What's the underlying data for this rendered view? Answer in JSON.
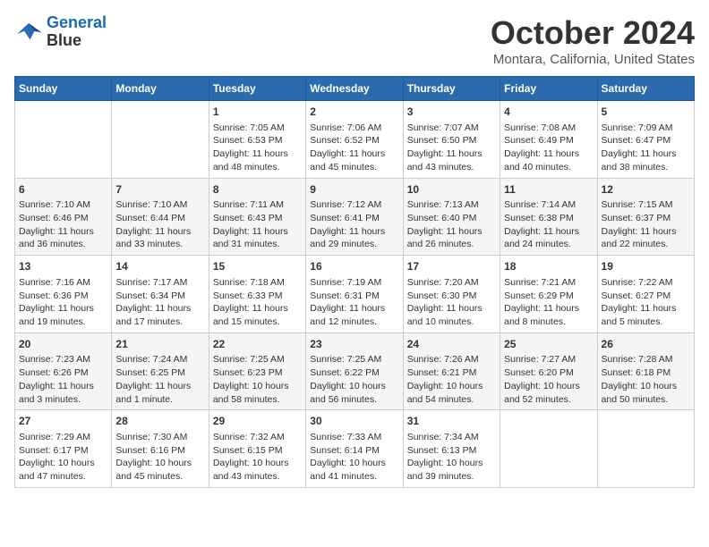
{
  "logo": {
    "line1": "General",
    "line2": "Blue"
  },
  "title": "October 2024",
  "location": "Montara, California, United States",
  "weekdays": [
    "Sunday",
    "Monday",
    "Tuesday",
    "Wednesday",
    "Thursday",
    "Friday",
    "Saturday"
  ],
  "weeks": [
    [
      {
        "day": "",
        "content": ""
      },
      {
        "day": "",
        "content": ""
      },
      {
        "day": "1",
        "content": "Sunrise: 7:05 AM\nSunset: 6:53 PM\nDaylight: 11 hours\nand 48 minutes."
      },
      {
        "day": "2",
        "content": "Sunrise: 7:06 AM\nSunset: 6:52 PM\nDaylight: 11 hours\nand 45 minutes."
      },
      {
        "day": "3",
        "content": "Sunrise: 7:07 AM\nSunset: 6:50 PM\nDaylight: 11 hours\nand 43 minutes."
      },
      {
        "day": "4",
        "content": "Sunrise: 7:08 AM\nSunset: 6:49 PM\nDaylight: 11 hours\nand 40 minutes."
      },
      {
        "day": "5",
        "content": "Sunrise: 7:09 AM\nSunset: 6:47 PM\nDaylight: 11 hours\nand 38 minutes."
      }
    ],
    [
      {
        "day": "6",
        "content": "Sunrise: 7:10 AM\nSunset: 6:46 PM\nDaylight: 11 hours\nand 36 minutes."
      },
      {
        "day": "7",
        "content": "Sunrise: 7:10 AM\nSunset: 6:44 PM\nDaylight: 11 hours\nand 33 minutes."
      },
      {
        "day": "8",
        "content": "Sunrise: 7:11 AM\nSunset: 6:43 PM\nDaylight: 11 hours\nand 31 minutes."
      },
      {
        "day": "9",
        "content": "Sunrise: 7:12 AM\nSunset: 6:41 PM\nDaylight: 11 hours\nand 29 minutes."
      },
      {
        "day": "10",
        "content": "Sunrise: 7:13 AM\nSunset: 6:40 PM\nDaylight: 11 hours\nand 26 minutes."
      },
      {
        "day": "11",
        "content": "Sunrise: 7:14 AM\nSunset: 6:38 PM\nDaylight: 11 hours\nand 24 minutes."
      },
      {
        "day": "12",
        "content": "Sunrise: 7:15 AM\nSunset: 6:37 PM\nDaylight: 11 hours\nand 22 minutes."
      }
    ],
    [
      {
        "day": "13",
        "content": "Sunrise: 7:16 AM\nSunset: 6:36 PM\nDaylight: 11 hours\nand 19 minutes."
      },
      {
        "day": "14",
        "content": "Sunrise: 7:17 AM\nSunset: 6:34 PM\nDaylight: 11 hours\nand 17 minutes."
      },
      {
        "day": "15",
        "content": "Sunrise: 7:18 AM\nSunset: 6:33 PM\nDaylight: 11 hours\nand 15 minutes."
      },
      {
        "day": "16",
        "content": "Sunrise: 7:19 AM\nSunset: 6:31 PM\nDaylight: 11 hours\nand 12 minutes."
      },
      {
        "day": "17",
        "content": "Sunrise: 7:20 AM\nSunset: 6:30 PM\nDaylight: 11 hours\nand 10 minutes."
      },
      {
        "day": "18",
        "content": "Sunrise: 7:21 AM\nSunset: 6:29 PM\nDaylight: 11 hours\nand 8 minutes."
      },
      {
        "day": "19",
        "content": "Sunrise: 7:22 AM\nSunset: 6:27 PM\nDaylight: 11 hours\nand 5 minutes."
      }
    ],
    [
      {
        "day": "20",
        "content": "Sunrise: 7:23 AM\nSunset: 6:26 PM\nDaylight: 11 hours\nand 3 minutes."
      },
      {
        "day": "21",
        "content": "Sunrise: 7:24 AM\nSunset: 6:25 PM\nDaylight: 11 hours\nand 1 minute."
      },
      {
        "day": "22",
        "content": "Sunrise: 7:25 AM\nSunset: 6:23 PM\nDaylight: 10 hours\nand 58 minutes."
      },
      {
        "day": "23",
        "content": "Sunrise: 7:25 AM\nSunset: 6:22 PM\nDaylight: 10 hours\nand 56 minutes."
      },
      {
        "day": "24",
        "content": "Sunrise: 7:26 AM\nSunset: 6:21 PM\nDaylight: 10 hours\nand 54 minutes."
      },
      {
        "day": "25",
        "content": "Sunrise: 7:27 AM\nSunset: 6:20 PM\nDaylight: 10 hours\nand 52 minutes."
      },
      {
        "day": "26",
        "content": "Sunrise: 7:28 AM\nSunset: 6:18 PM\nDaylight: 10 hours\nand 50 minutes."
      }
    ],
    [
      {
        "day": "27",
        "content": "Sunrise: 7:29 AM\nSunset: 6:17 PM\nDaylight: 10 hours\nand 47 minutes."
      },
      {
        "day": "28",
        "content": "Sunrise: 7:30 AM\nSunset: 6:16 PM\nDaylight: 10 hours\nand 45 minutes."
      },
      {
        "day": "29",
        "content": "Sunrise: 7:32 AM\nSunset: 6:15 PM\nDaylight: 10 hours\nand 43 minutes."
      },
      {
        "day": "30",
        "content": "Sunrise: 7:33 AM\nSunset: 6:14 PM\nDaylight: 10 hours\nand 41 minutes."
      },
      {
        "day": "31",
        "content": "Sunrise: 7:34 AM\nSunset: 6:13 PM\nDaylight: 10 hours\nand 39 minutes."
      },
      {
        "day": "",
        "content": ""
      },
      {
        "day": "",
        "content": ""
      }
    ]
  ]
}
